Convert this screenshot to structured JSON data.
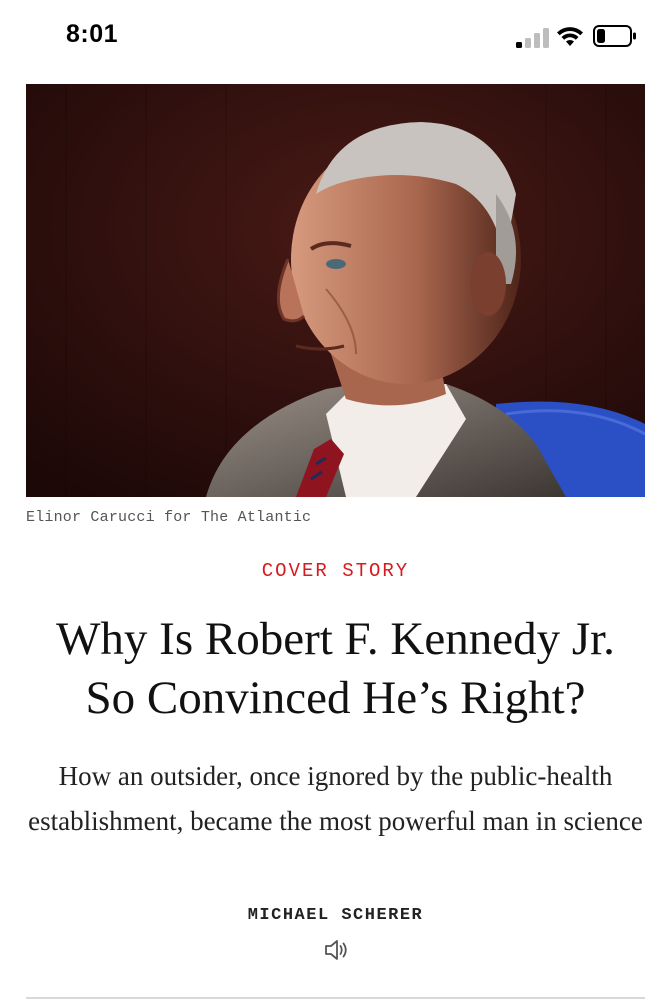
{
  "status_bar": {
    "time": "8:01",
    "icons": [
      "cellular-signal-icon",
      "wifi-icon",
      "battery-icon"
    ]
  },
  "hero": {
    "photo_credit": "Elinor Carucci for The Atlantic"
  },
  "article": {
    "kicker": "COVER STORY",
    "headline_line1": "Why Is Robert F. Kennedy Jr.",
    "headline_line2": "So Convinced He’s Right?",
    "dek": "How an outsider, once ignored by the public-health establishment, became the most powerful man in science",
    "byline": "MICHAEL SCHERER",
    "audio_icon": "speaker-icon"
  },
  "colors": {
    "kicker": "#d71920",
    "photo_background": "#2a0d0c"
  }
}
